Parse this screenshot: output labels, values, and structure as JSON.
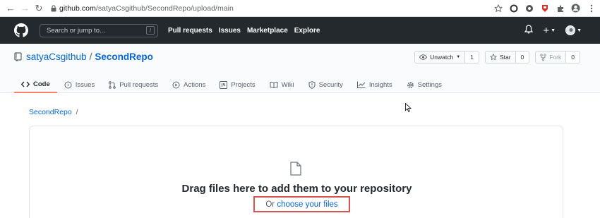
{
  "browser": {
    "url_host": "github.com",
    "url_path": "/satyaCsgithub/SecondRepo/upload/main",
    "icons": [
      "back-icon",
      "forward-icon",
      "reload-icon",
      "lock-icon",
      "star-icon",
      "extension-icons",
      "avatar",
      "menu-icon"
    ]
  },
  "header": {
    "search_placeholder": "Search or jump to...",
    "slash_hint": "/",
    "nav": [
      "Pull requests",
      "Issues",
      "Marketplace",
      "Explore"
    ]
  },
  "repo": {
    "owner": "satyaCsgithub",
    "separator": "/",
    "name": "SecondRepo",
    "unwatch_label": "Unwatch",
    "unwatch_count": "1",
    "star_label": "Star",
    "star_count": "0",
    "fork_label": "Fork",
    "fork_count": "0"
  },
  "tabs": [
    {
      "label": "Code",
      "icon": "code-icon",
      "selected": true
    },
    {
      "label": "Issues",
      "icon": "issue-icon",
      "selected": false
    },
    {
      "label": "Pull requests",
      "icon": "pull-request-icon",
      "selected": false
    },
    {
      "label": "Actions",
      "icon": "play-icon",
      "selected": false
    },
    {
      "label": "Projects",
      "icon": "project-icon",
      "selected": false
    },
    {
      "label": "Wiki",
      "icon": "book-icon",
      "selected": false
    },
    {
      "label": "Security",
      "icon": "shield-icon",
      "selected": false
    },
    {
      "label": "Insights",
      "icon": "graph-icon",
      "selected": false
    },
    {
      "label": "Settings",
      "icon": "gear-icon",
      "selected": false
    }
  ],
  "breadcrumb": {
    "repo_link": "SecondRepo",
    "separator": "/"
  },
  "upload": {
    "title": "Drag files here to add them to your repository",
    "choose_prefix": "Or",
    "choose_link": "choose your files"
  },
  "colors": {
    "header_bg": "#24292e",
    "link": "#0366d6",
    "tab_underline": "#f9826c",
    "highlight_box": "#d9534f"
  }
}
